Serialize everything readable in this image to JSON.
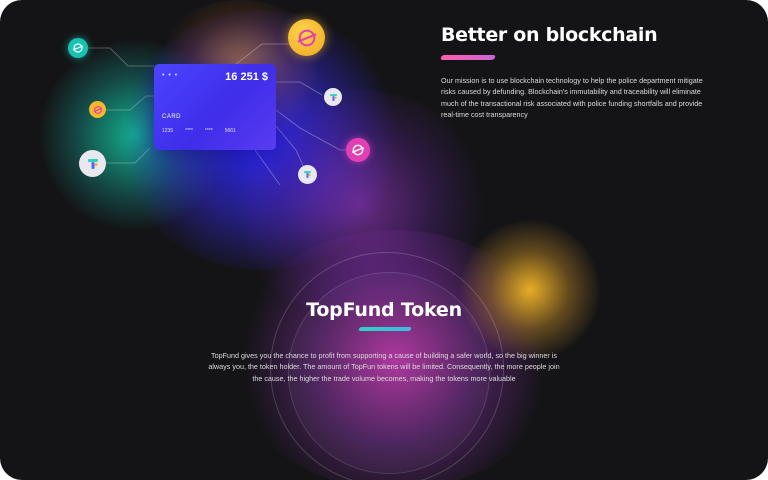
{
  "card": {
    "dots": "• • •",
    "amount": "16 251 $",
    "label": "CARD",
    "number_groups": [
      "1235",
      "****",
      "****",
      "5661"
    ]
  },
  "blockchain": {
    "title": "Better on blockchain",
    "body": "Our mission is to use blockchain technology to help the police department mitigate risks caused by defunding. Blockchain's immutability and traceability will eliminate much of the transactional risk associated with police funding shortfalls and provide real-time cost transparency"
  },
  "token": {
    "title": "TopFund Token",
    "body": "TopFund gives you the chance to profit from supporting a cause of building a safer world, so the big winner is always you, the token holder. The amount of TopFun tokens will be limited. Consequently, the more people join the cause, the higher the trade volume becomes, making the tokens more valuable"
  },
  "coins": [
    {
      "icon": "stellar-coin-icon",
      "color": "#19c3b3"
    },
    {
      "icon": "stellar-coin-icon",
      "color": "#f5b82a"
    },
    {
      "icon": "topfund-coin-icon",
      "color": "#e8e8ee"
    },
    {
      "icon": "stellar-coin-icon",
      "color": "#f7c02a"
    },
    {
      "icon": "topfund-coin-icon",
      "color": "#e8e8ee"
    },
    {
      "icon": "stellar-coin-icon",
      "color": "#e23fb4"
    },
    {
      "icon": "topfund-coin-icon",
      "color": "#e8e8ee"
    }
  ],
  "colors": {
    "background": "#141416",
    "accent_pink": "#ff5fa8",
    "accent_teal": "#2ad3c6",
    "card": "#4b45ff"
  }
}
